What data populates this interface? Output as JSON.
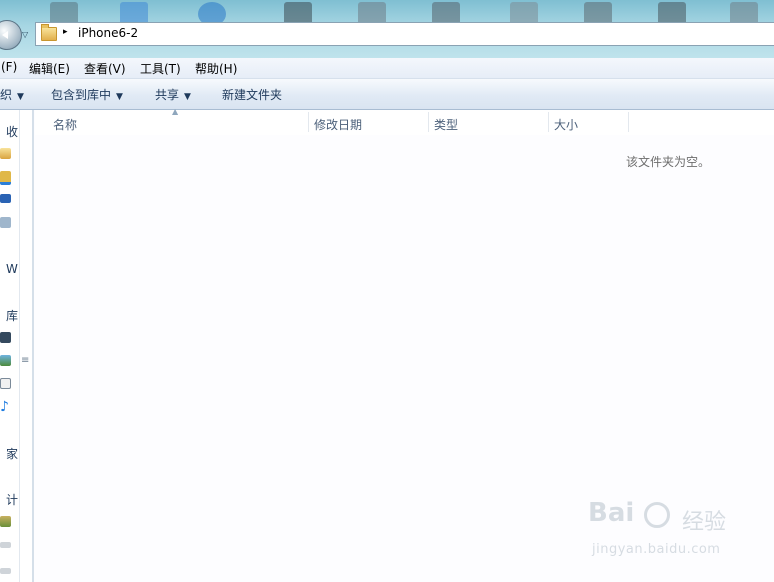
{
  "address_bar": {
    "path_segment": "iPhone6-2",
    "folder_icon": "folder-icon",
    "breadcrumb_arrow": "▸",
    "history_dropdown": "▽"
  },
  "menu": {
    "items": [
      "(F)",
      "编辑(E)",
      "查看(V)",
      "工具(T)",
      "帮助(H)"
    ]
  },
  "toolbar": {
    "organize_partial": "织",
    "include_in_library": "包含到库中",
    "share": "共享",
    "new_folder": "新建文件夹"
  },
  "nav_pane": {
    "items": [
      {
        "text": "收",
        "icon": "favorites-star-icon"
      },
      {
        "text": "",
        "icon": "desktop-folder-icon"
      },
      {
        "text": "",
        "icon": "downloads-icon"
      },
      {
        "text": "",
        "icon": "desktop-icon"
      },
      {
        "text": "",
        "icon": "recent-places-icon"
      },
      {
        "text": "W",
        "icon": "wps-cloud-icon"
      },
      {
        "text": "库",
        "icon": "libraries-icon"
      },
      {
        "text": "",
        "icon": "videos-icon"
      },
      {
        "text": "",
        "icon": "pictures-icon"
      },
      {
        "text": "",
        "icon": "documents-icon"
      },
      {
        "text": "",
        "icon": "music-icon"
      },
      {
        "text": "家",
        "icon": "homegroup-icon"
      },
      {
        "text": "计",
        "icon": "computer-icon"
      },
      {
        "text": "",
        "icon": "local-disk-icon"
      },
      {
        "text": "",
        "icon": "drive-icon"
      },
      {
        "text": "",
        "icon": "drive-icon"
      }
    ]
  },
  "columns": [
    "名称",
    "修改日期",
    "类型",
    "大小"
  ],
  "content": {
    "empty_message": "该文件夹为空。"
  },
  "watermark": {
    "logo_left": "Bai",
    "logo_right": "经验",
    "url": "jingyan.baidu.com"
  },
  "colors": {
    "title_gradient_top": "#7fbfd2",
    "command_bar": "#dfe9f5",
    "header_text": "#4c607a",
    "accent": "#1e395b"
  }
}
